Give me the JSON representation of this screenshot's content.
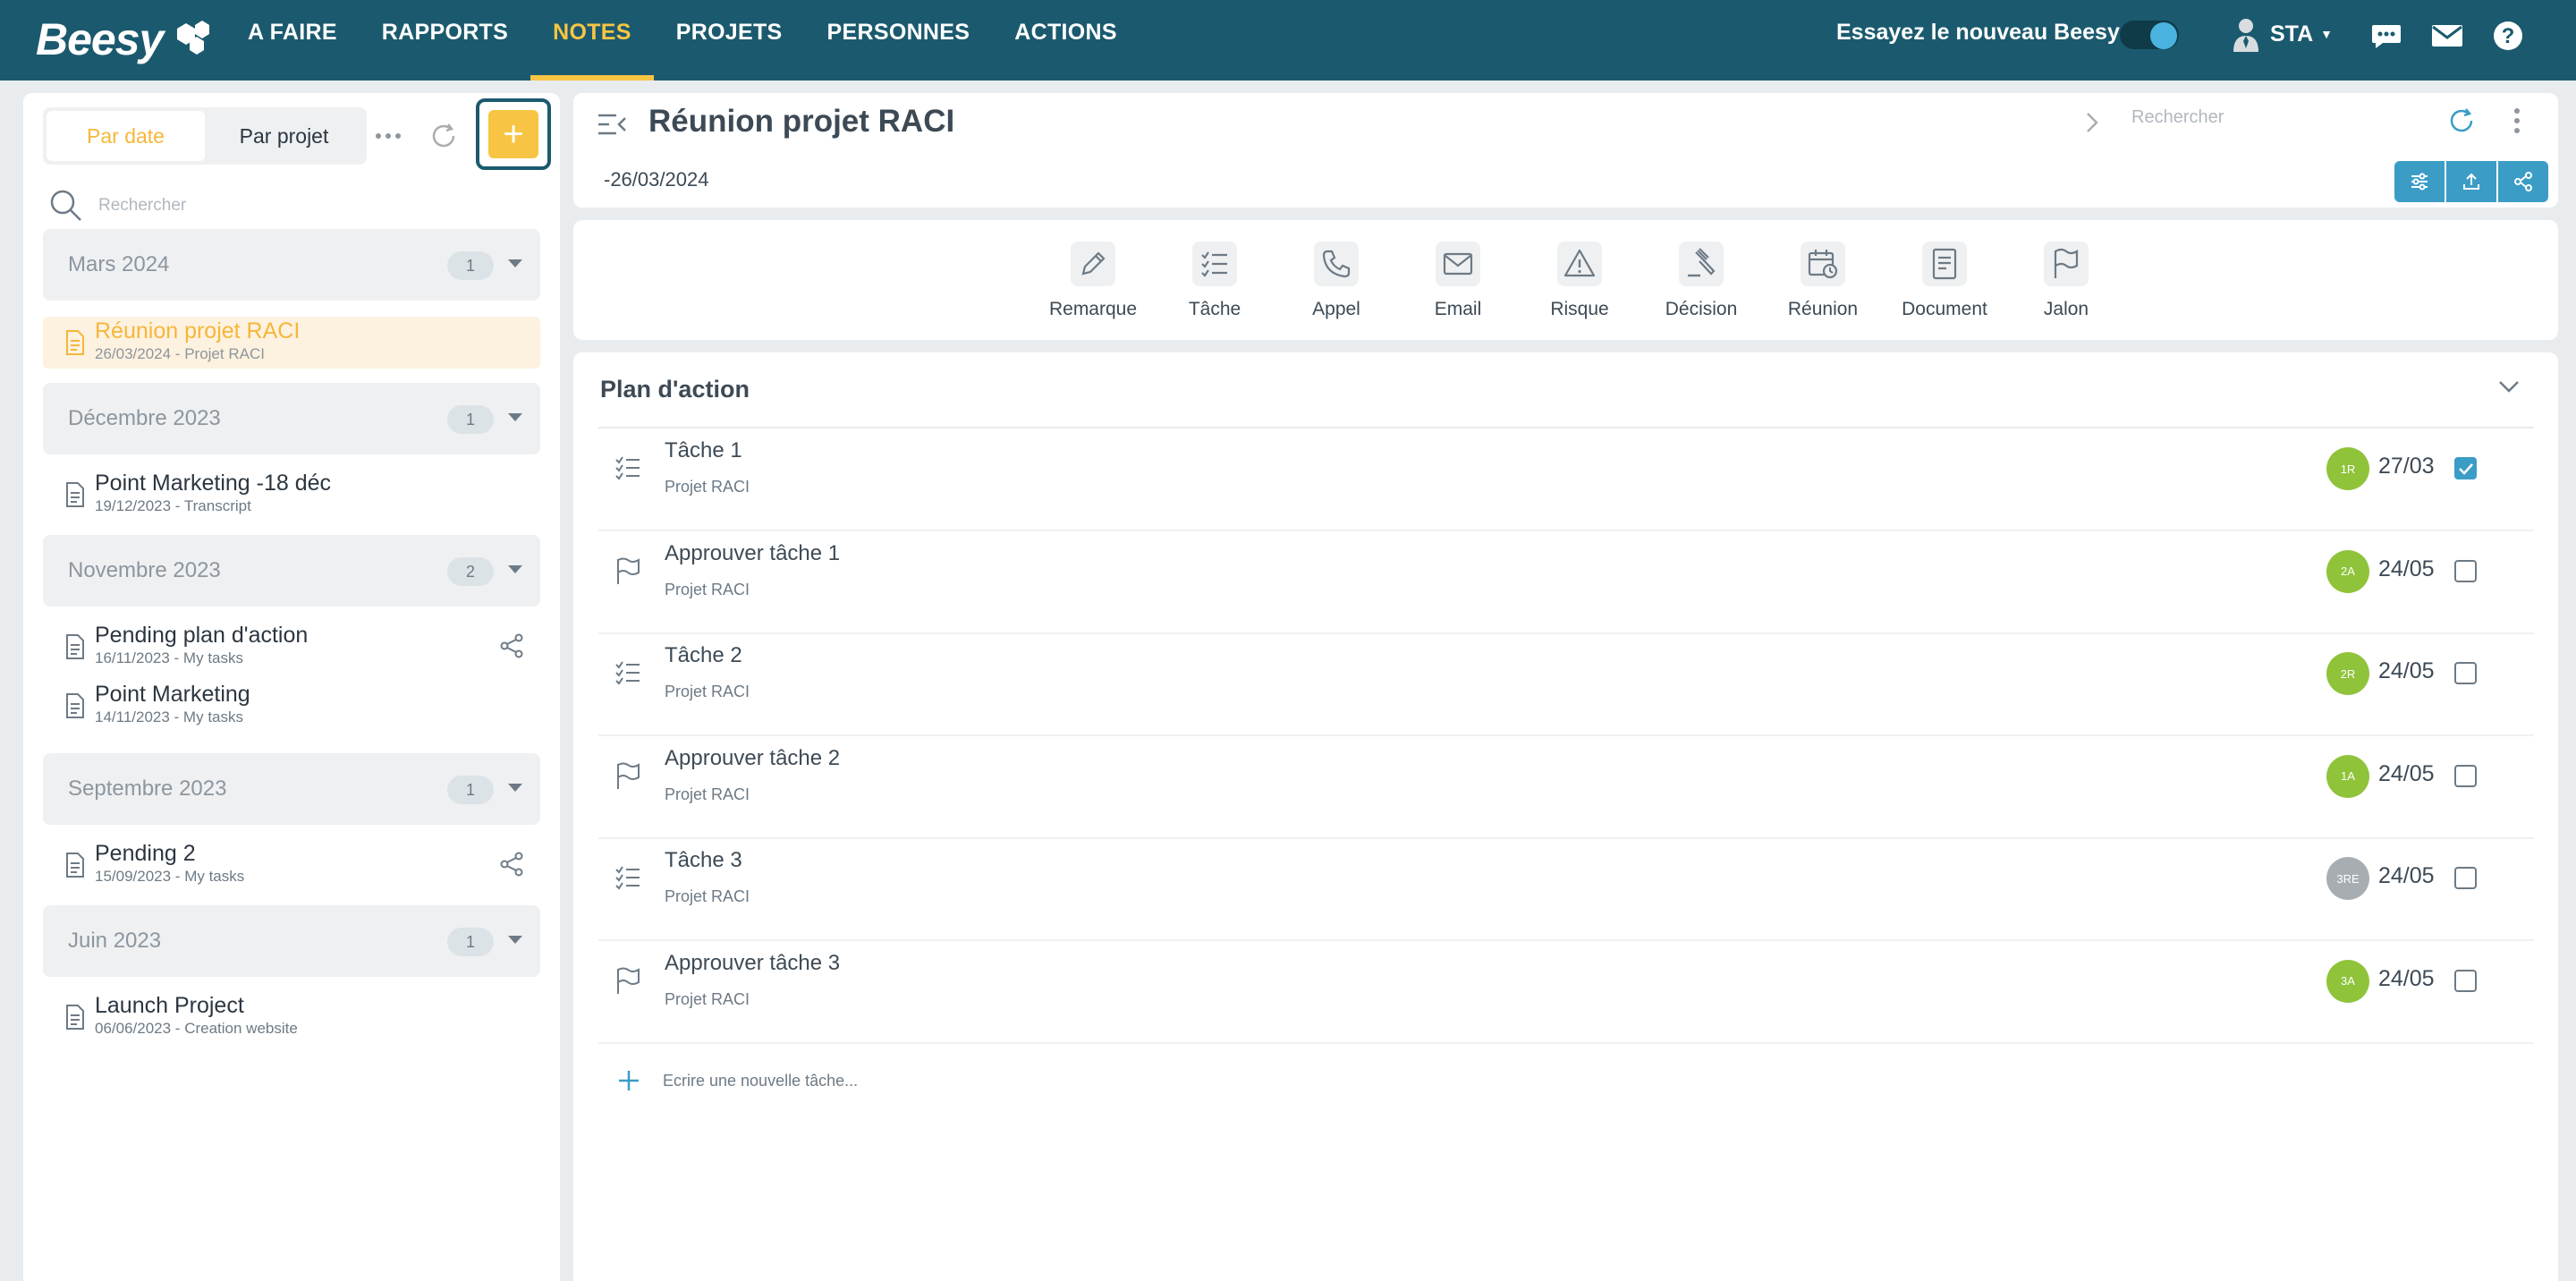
{
  "app": {
    "logo_text": "Beesy"
  },
  "nav": [
    {
      "label": "A FAIRE",
      "active": false
    },
    {
      "label": "RAPPORTS",
      "active": false
    },
    {
      "label": "NOTES",
      "active": true
    },
    {
      "label": "PROJETS",
      "active": false
    },
    {
      "label": "PERSONNES",
      "active": false
    },
    {
      "label": "ACTIONS",
      "active": false
    }
  ],
  "topbar": {
    "try_text": "Essayez le nouveau Beesy",
    "toggle_on": true,
    "user_label": "STA",
    "icons": [
      "chat-icon",
      "mail-icon",
      "help-icon"
    ]
  },
  "sidebar": {
    "tabs": [
      "Par date",
      "Par projet"
    ],
    "search_placeholder": "Rechercher",
    "groups": [
      {
        "title": "Mars 2024",
        "count": "1",
        "notes": [
          {
            "title": "Réunion projet RACI",
            "sub": "26/03/2024 - Projet RACI",
            "selected": true,
            "shared": false
          }
        ]
      },
      {
        "title": "Décembre 2023",
        "count": "1",
        "notes": [
          {
            "title": "Point Marketing -18 déc",
            "sub": "19/12/2023 - Transcript",
            "selected": false,
            "shared": false
          }
        ]
      },
      {
        "title": "Novembre 2023",
        "count": "2",
        "notes": [
          {
            "title": "Pending plan d'action",
            "sub": "16/11/2023 - My tasks",
            "selected": false,
            "shared": true
          },
          {
            "title": "Point Marketing",
            "sub": "14/11/2023 - My tasks",
            "selected": false,
            "shared": false
          }
        ]
      },
      {
        "title": "Septembre 2023",
        "count": "1",
        "notes": [
          {
            "title": "Pending 2",
            "sub": "15/09/2023 - My tasks",
            "selected": false,
            "shared": true
          }
        ]
      },
      {
        "title": "Juin 2023",
        "count": "1",
        "notes": [
          {
            "title": "Launch Project",
            "sub": "06/06/2023 - Creation website",
            "selected": false,
            "shared": false
          }
        ]
      }
    ]
  },
  "header": {
    "title": "Réunion projet RACI",
    "date": "-26/03/2024",
    "search_placeholder": "Rechercher"
  },
  "types": [
    "Remarque",
    "Tâche",
    "Appel",
    "Email",
    "Risque",
    "Décision",
    "Réunion",
    "Document",
    "Jalon"
  ],
  "plan": {
    "title": "Plan d'action",
    "new_task_placeholder": "Ecrire une nouvelle tâche...",
    "tasks": [
      {
        "name": "Tâche 1",
        "project": "Projet RACI",
        "kind": "task",
        "avatar": "1R",
        "avatar_color": "#8fc33a",
        "date": "27/03",
        "done": true
      },
      {
        "name": "Approuver tâche 1",
        "project": "Projet RACI",
        "kind": "milestone",
        "avatar": "2A",
        "avatar_color": "#8fc33a",
        "date": "24/05",
        "done": false
      },
      {
        "name": "Tâche 2",
        "project": "Projet RACI",
        "kind": "task",
        "avatar": "2R",
        "avatar_color": "#8fc33a",
        "date": "24/05",
        "done": false
      },
      {
        "name": "Approuver tâche 2",
        "project": "Projet RACI",
        "kind": "milestone",
        "avatar": "1A",
        "avatar_color": "#8fc33a",
        "date": "24/05",
        "done": false
      },
      {
        "name": "Tâche 3",
        "project": "Projet RACI",
        "kind": "task",
        "avatar": "3RE",
        "avatar_color": "#a8adb2",
        "date": "24/05",
        "done": false
      },
      {
        "name": "Approuver tâche 3",
        "project": "Projet RACI",
        "kind": "milestone",
        "avatar": "3A",
        "avatar_color": "#8fc33a",
        "date": "24/05",
        "done": false
      }
    ]
  },
  "colors": {
    "brand": "#1b5a6e",
    "accent": "#f7c543",
    "action_blue": "#3b9cc6"
  }
}
